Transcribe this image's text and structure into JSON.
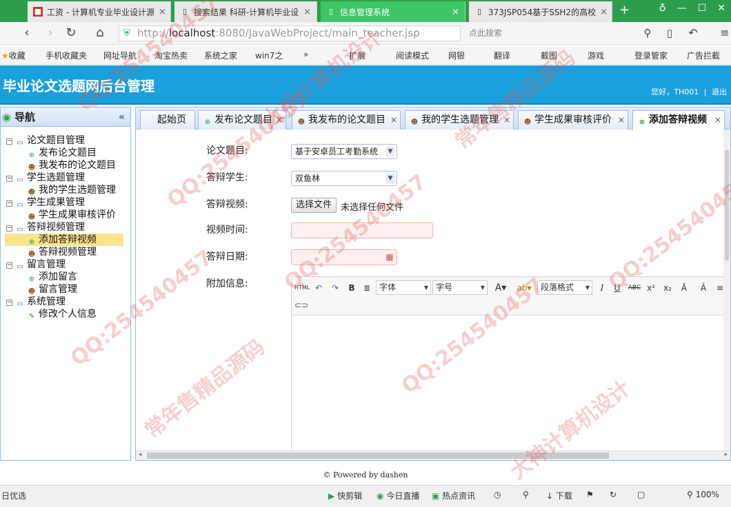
{
  "browser": {
    "tabs": [
      {
        "title": "工资 - 计算机专业毕业设计源",
        "icon": "document-icon"
      },
      {
        "title": "搜索结果 科研-计算机毕业设",
        "icon": "page-icon"
      },
      {
        "title": "信息管理系统",
        "icon": "page-icon",
        "active": true
      },
      {
        "title": "373JSP054基于SSH2的高校",
        "icon": "page-icon"
      }
    ],
    "new_tab": "+",
    "url_scheme": "http://",
    "url_host": "localhost",
    "url_rest": ":8080/JavaWebProject/main_teacher.jsp",
    "search_placeholder": "点此搜索",
    "bookmarks": [
      "收藏",
      "手机收藏夹",
      "网址导航",
      "淘宝热卖",
      "系统之家",
      "win7之",
      "»",
      "扩展",
      "阅读模式",
      "网银",
      "翻译",
      "截图",
      "游戏",
      "登录管家",
      "广告拦截"
    ]
  },
  "header": {
    "title": "毕业论文选题网后台管理",
    "user_greeting": "您好，TH001",
    "logout": "退出"
  },
  "nav": {
    "title": "导航",
    "collapse": "«",
    "groups": [
      {
        "label": "论文题目管理",
        "items": [
          "发布论文题目",
          "我发布的论文题目"
        ]
      },
      {
        "label": "学生选题管理",
        "items": [
          "我的学生选题管理"
        ]
      },
      {
        "label": "学生成果管理",
        "items": [
          "学生成果审核评价"
        ]
      },
      {
        "label": "答辩视频管理",
        "items": [
          "添加答辩视频",
          "答辩视频管理"
        ]
      },
      {
        "label": "留言管理",
        "items": [
          "添加留言",
          "留言管理"
        ]
      },
      {
        "label": "系统管理",
        "items": [
          "修改个人信息"
        ]
      }
    ],
    "selected": "添加答辩视频"
  },
  "content_tabs": [
    "起始页",
    "发布论文题目",
    "我发布的论文题目",
    "我的学生选题管理",
    "学生成果审核评价",
    "添加答辩视频"
  ],
  "form": {
    "title_label": "论文题目:",
    "title_value": "基于安卓员工考勤系统",
    "student_label": "答辩学生:",
    "student_value": "双鱼林",
    "video_label": "答辩视频:",
    "file_button": "选择文件",
    "file_none": "未选择任何文件",
    "time_label": "视频时间:",
    "date_label": "答辩日期:",
    "extra_label": "附加信息:"
  },
  "editor_toolbar": {
    "html": "HTML",
    "bold": "B",
    "font": "字体",
    "size": "字号",
    "paragraph": "段落格式",
    "italic": "I",
    "underline": "U",
    "strike": "ABC"
  },
  "footer": "© Powered by dashen",
  "status": {
    "left": "日优选",
    "items": [
      "快剪辑",
      "今日直播",
      "热点资讯",
      "下载"
    ],
    "zoom": "100%"
  },
  "watermark": [
    "QQ:254540457",
    "常年售精品源码",
    "大神计算机设计"
  ]
}
